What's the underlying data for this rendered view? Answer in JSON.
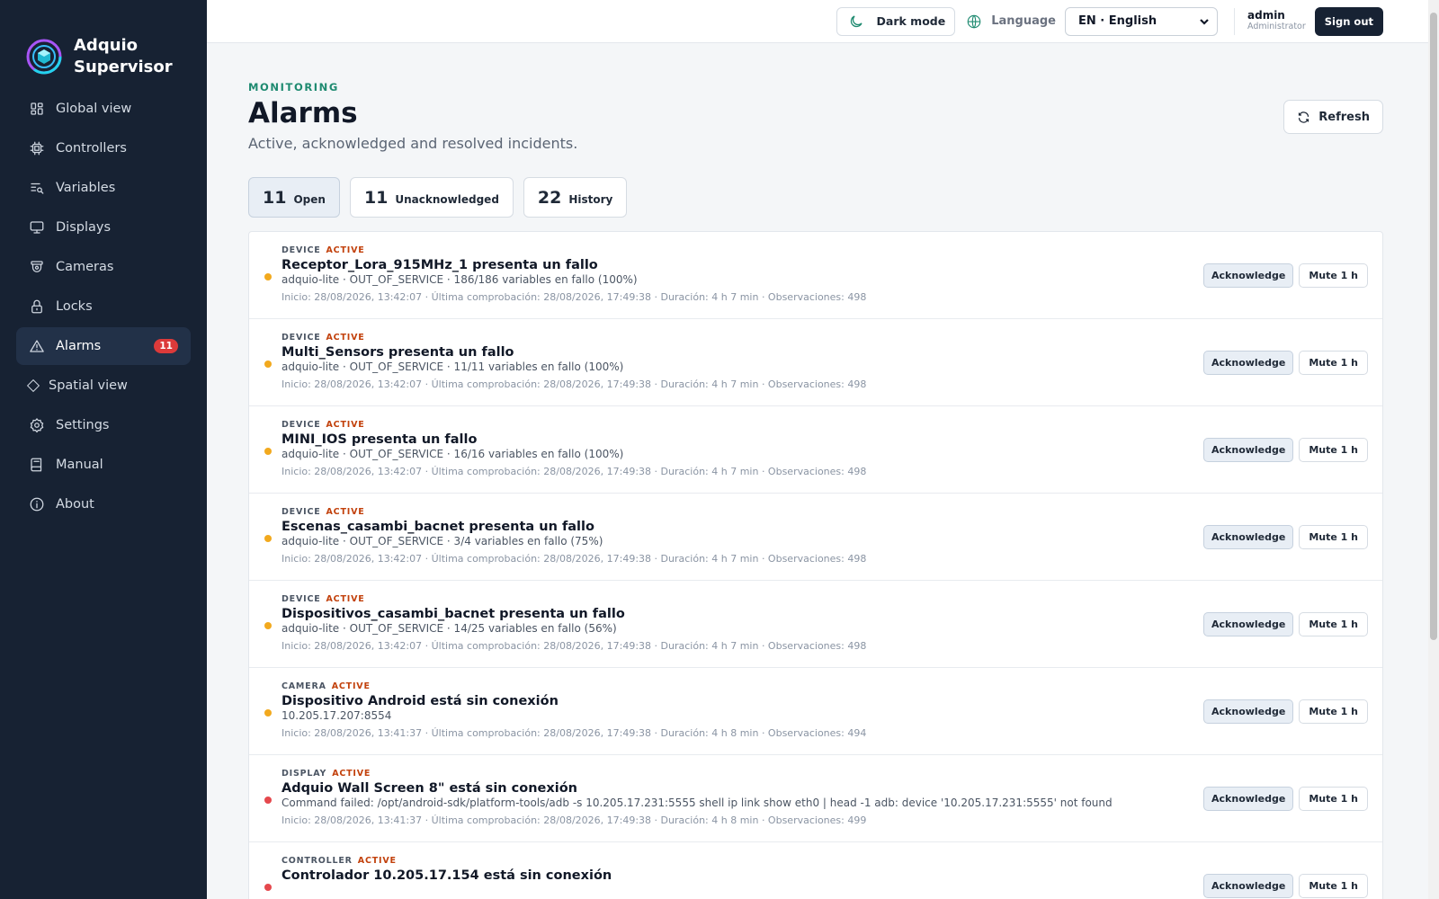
{
  "app": {
    "name_line1": "Adquio",
    "name_line2": "Supervisor",
    "logo_icon": "adquio-logo-icon",
    "brand_color": "#1e8a70",
    "sidebar_bg": "#172233"
  },
  "sidebar": {
    "items": [
      {
        "label": "Global view",
        "icon": "grid-icon"
      },
      {
        "label": "Controllers",
        "icon": "chip-icon"
      },
      {
        "label": "Variables",
        "icon": "list-search-icon"
      },
      {
        "label": "Displays",
        "icon": "monitor-icon"
      },
      {
        "label": "Cameras",
        "icon": "camera-icon"
      },
      {
        "label": "Locks",
        "icon": "lock-icon"
      },
      {
        "label": "Alarms",
        "icon": "warning-icon",
        "badge": "11",
        "active": true
      },
      {
        "label": "Spatial view",
        "icon": "diamond-icon"
      },
      {
        "label": "Settings",
        "icon": "gear-icon"
      },
      {
        "label": "Manual",
        "icon": "book-icon"
      },
      {
        "label": "About",
        "icon": "info-icon"
      }
    ]
  },
  "topbar": {
    "dark_mode_label": "Dark mode",
    "language_label": "Language",
    "language_value": "EN · English",
    "user_name": "admin",
    "user_role": "Administrator",
    "sign_out_label": "Sign out"
  },
  "page": {
    "eyebrow": "MONITORING",
    "title": "Alarms",
    "subtitle": "Active, acknowledged and resolved incidents.",
    "refresh_label": "Refresh"
  },
  "tabs": [
    {
      "count": "11",
      "label": "Open",
      "active": true
    },
    {
      "count": "11",
      "label": "Unacknowledged"
    },
    {
      "count": "22",
      "label": "History"
    }
  ],
  "alarm_actions": {
    "ack_label": "Acknowledge",
    "mute_label": "Mute 1 h"
  },
  "status_colors": {
    "warning": "#f2a91e",
    "critical": "#e5484d"
  },
  "alarms": [
    {
      "type": "DEVICE",
      "state": "ACTIVE",
      "severity": "warning",
      "title": "Receptor_Lora_915MHz_1 presenta un fallo",
      "detail": "adquio-lite · OUT_OF_SERVICE · 186/186 variables en fallo (100%)",
      "meta": "Inicio: 28/08/2026, 13:42:07 · Última comprobación: 28/08/2026, 17:49:38 · Duración: 4 h 7 min · Observaciones: 498"
    },
    {
      "type": "DEVICE",
      "state": "ACTIVE",
      "severity": "warning",
      "title": "Multi_Sensors presenta un fallo",
      "detail": "adquio-lite · OUT_OF_SERVICE · 11/11 variables en fallo (100%)",
      "meta": "Inicio: 28/08/2026, 13:42:07 · Última comprobación: 28/08/2026, 17:49:38 · Duración: 4 h 7 min · Observaciones: 498"
    },
    {
      "type": "DEVICE",
      "state": "ACTIVE",
      "severity": "warning",
      "title": "MINI_IOS presenta un fallo",
      "detail": "adquio-lite · OUT_OF_SERVICE · 16/16 variables en fallo (100%)",
      "meta": "Inicio: 28/08/2026, 13:42:07 · Última comprobación: 28/08/2026, 17:49:38 · Duración: 4 h 7 min · Observaciones: 498"
    },
    {
      "type": "DEVICE",
      "state": "ACTIVE",
      "severity": "warning",
      "title": "Escenas_casambi_bacnet presenta un fallo",
      "detail": "adquio-lite · OUT_OF_SERVICE · 3/4 variables en fallo (75%)",
      "meta": "Inicio: 28/08/2026, 13:42:07 · Última comprobación: 28/08/2026, 17:49:38 · Duración: 4 h 7 min · Observaciones: 498"
    },
    {
      "type": "DEVICE",
      "state": "ACTIVE",
      "severity": "warning",
      "title": "Dispositivos_casambi_bacnet presenta un fallo",
      "detail": "adquio-lite · OUT_OF_SERVICE · 14/25 variables en fallo (56%)",
      "meta": "Inicio: 28/08/2026, 13:42:07 · Última comprobación: 28/08/2026, 17:49:38 · Duración: 4 h 7 min · Observaciones: 498"
    },
    {
      "type": "CAMERA",
      "state": "ACTIVE",
      "severity": "warning",
      "title": "Dispositivo Android está sin conexión",
      "detail": "10.205.17.207:8554",
      "meta": "Inicio: 28/08/2026, 13:41:37 · Última comprobación: 28/08/2026, 17:49:38 · Duración: 4 h 8 min · Observaciones: 494"
    },
    {
      "type": "DISPLAY",
      "state": "ACTIVE",
      "severity": "critical",
      "title": "Adquio Wall Screen 8\" está sin conexión",
      "detail": "Command failed: /opt/android-sdk/platform-tools/adb -s 10.205.17.231:5555 shell ip link show eth0 | head -1 adb: device '10.205.17.231:5555' not found",
      "meta": "Inicio: 28/08/2026, 13:41:37 · Última comprobación: 28/08/2026, 17:49:38 · Duración: 4 h 8 min · Observaciones: 499"
    },
    {
      "type": "CONTROLLER",
      "state": "ACTIVE",
      "severity": "critical",
      "title": "Controlador 10.205.17.154 está sin conexión",
      "detail": "",
      "meta": ""
    }
  ]
}
